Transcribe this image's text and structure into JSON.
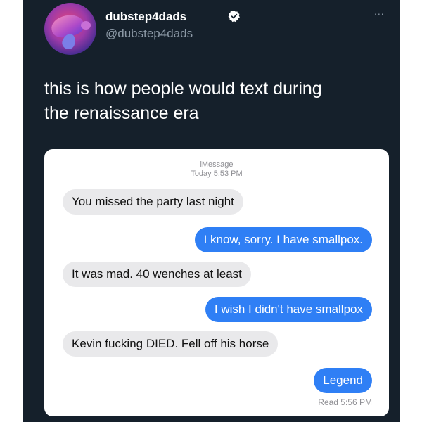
{
  "tweet": {
    "display_name": "dubstep4dads",
    "handle": "@dubstep4dads",
    "more_label": "...",
    "text_line1": "this is how people would text during",
    "text_line2": "the renaissance era",
    "avatar_icon": "turtle-avatar",
    "verified_icon": "verified-badge-icon",
    "colors": {
      "background": "#15202b",
      "text": "#ffffff",
      "secondary": "#8b98a5"
    }
  },
  "imessage": {
    "service_label": "iMessage",
    "timestamp": "Today 5:53 PM",
    "messages": [
      {
        "direction": "received",
        "text": "You missed the party last night"
      },
      {
        "direction": "sent",
        "text": "I know, sorry. I have smallpox."
      },
      {
        "direction": "received",
        "text": "It was mad. 40 wenches at least"
      },
      {
        "direction": "sent",
        "text": "I wish I didn't have smallpox"
      },
      {
        "direction": "received",
        "text": "Kevin fucking DIED. Fell off his horse"
      },
      {
        "direction": "sent",
        "text": "Legend"
      }
    ],
    "read_receipt": "Read 5:56 PM",
    "colors": {
      "sent_bubble": "#2f7ff5",
      "received_bubble": "#e9e9eb",
      "meta_text": "#8e8e93"
    }
  }
}
